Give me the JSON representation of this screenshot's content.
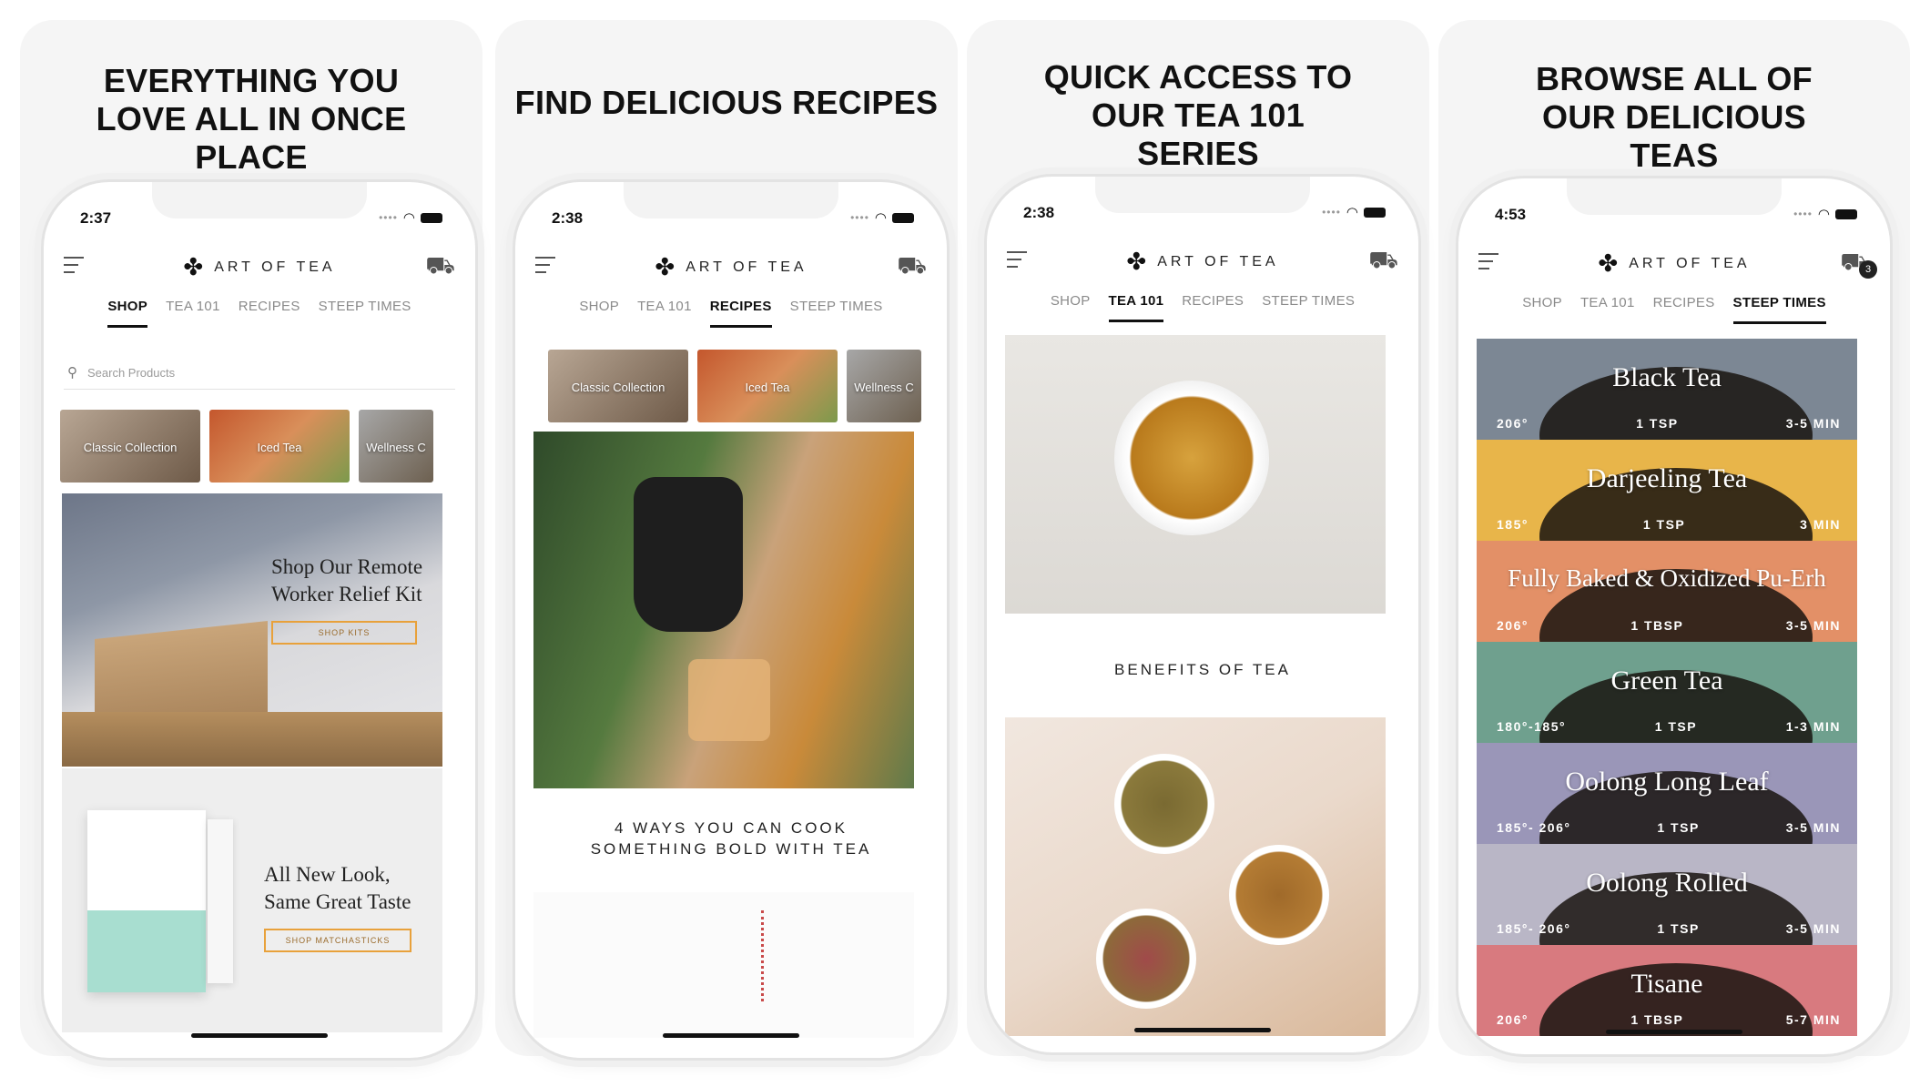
{
  "screens": [
    {
      "headline": "EVERYTHING YOU LOVE ALL IN ONCE PLACE",
      "time": "2:37",
      "logo": "ART OF TEA",
      "tabs": [
        "SHOP",
        "TEA 101",
        "RECIPES",
        "STEEP TIMES"
      ],
      "active_tab": "SHOP",
      "search_placeholder": "Search Products",
      "thumbs": [
        "Classic Collection",
        "Iced Tea",
        "Wellness C"
      ],
      "hero1_title": "Shop Our Remote Worker Relief Kit",
      "hero1_cta": "SHOP KITS",
      "hero2_title": "All New Look, Same Great Taste",
      "hero2_cta": "SHOP MATCHASTICKS"
    },
    {
      "headline": "FIND DELICIOUS RECIPES",
      "time": "2:38",
      "logo": "ART OF TEA",
      "tabs": [
        "SHOP",
        "TEA 101",
        "RECIPES",
        "STEEP TIMES"
      ],
      "active_tab": "RECIPES",
      "thumbs": [
        "Classic Collection",
        "Iced Tea",
        "Wellness C"
      ],
      "caption": "4 WAYS YOU CAN COOK SOMETHING BOLD WITH TEA"
    },
    {
      "headline": "QUICK ACCESS TO OUR TEA 101 SERIES",
      "time": "2:38",
      "logo": "ART OF TEA",
      "tabs": [
        "SHOP",
        "TEA 101",
        "RECIPES",
        "STEEP TIMES"
      ],
      "active_tab": "TEA 101",
      "caption": "BENEFITS OF TEA"
    },
    {
      "headline": "BROWSE ALL OF OUR DELICIOUS TEAS",
      "time": "4:53",
      "logo": "ART OF TEA",
      "tabs": [
        "SHOP",
        "TEA 101",
        "RECIPES",
        "STEEP TIMES"
      ],
      "active_tab": "STEEP TIMES",
      "cart_count": "3",
      "teas": [
        {
          "name": "Black Tea",
          "temp": "206°",
          "amount": "1 TSP",
          "time": "3-5 MIN",
          "color": "#7c8794"
        },
        {
          "name": "Darjeeling Tea",
          "temp": "185°",
          "amount": "1 TSP",
          "time": "3 MIN",
          "color": "#e8b54a"
        },
        {
          "name": "Fully Baked & Oxidized Pu-Erh",
          "temp": "206°",
          "amount": "1 TBSP",
          "time": "3-5 MIN",
          "color": "#e39067"
        },
        {
          "name": "Green Tea",
          "temp": "180°-185°",
          "amount": "1 TSP",
          "time": "1-3 MIN",
          "color": "#6fa08e"
        },
        {
          "name": "Oolong Long Leaf",
          "temp": "185°- 206°",
          "amount": "1 TSP",
          "time": "3-5 MIN",
          "color": "#9a96b8"
        },
        {
          "name": "Oolong Rolled",
          "temp": "185°- 206°",
          "amount": "1 TSP",
          "time": "3-5 MIN",
          "color": "#b9b6c6"
        },
        {
          "name": "Tisane",
          "temp": "206°",
          "amount": "1 TBSP",
          "time": "5-7 MIN",
          "color": "#d87a7f"
        }
      ]
    }
  ]
}
